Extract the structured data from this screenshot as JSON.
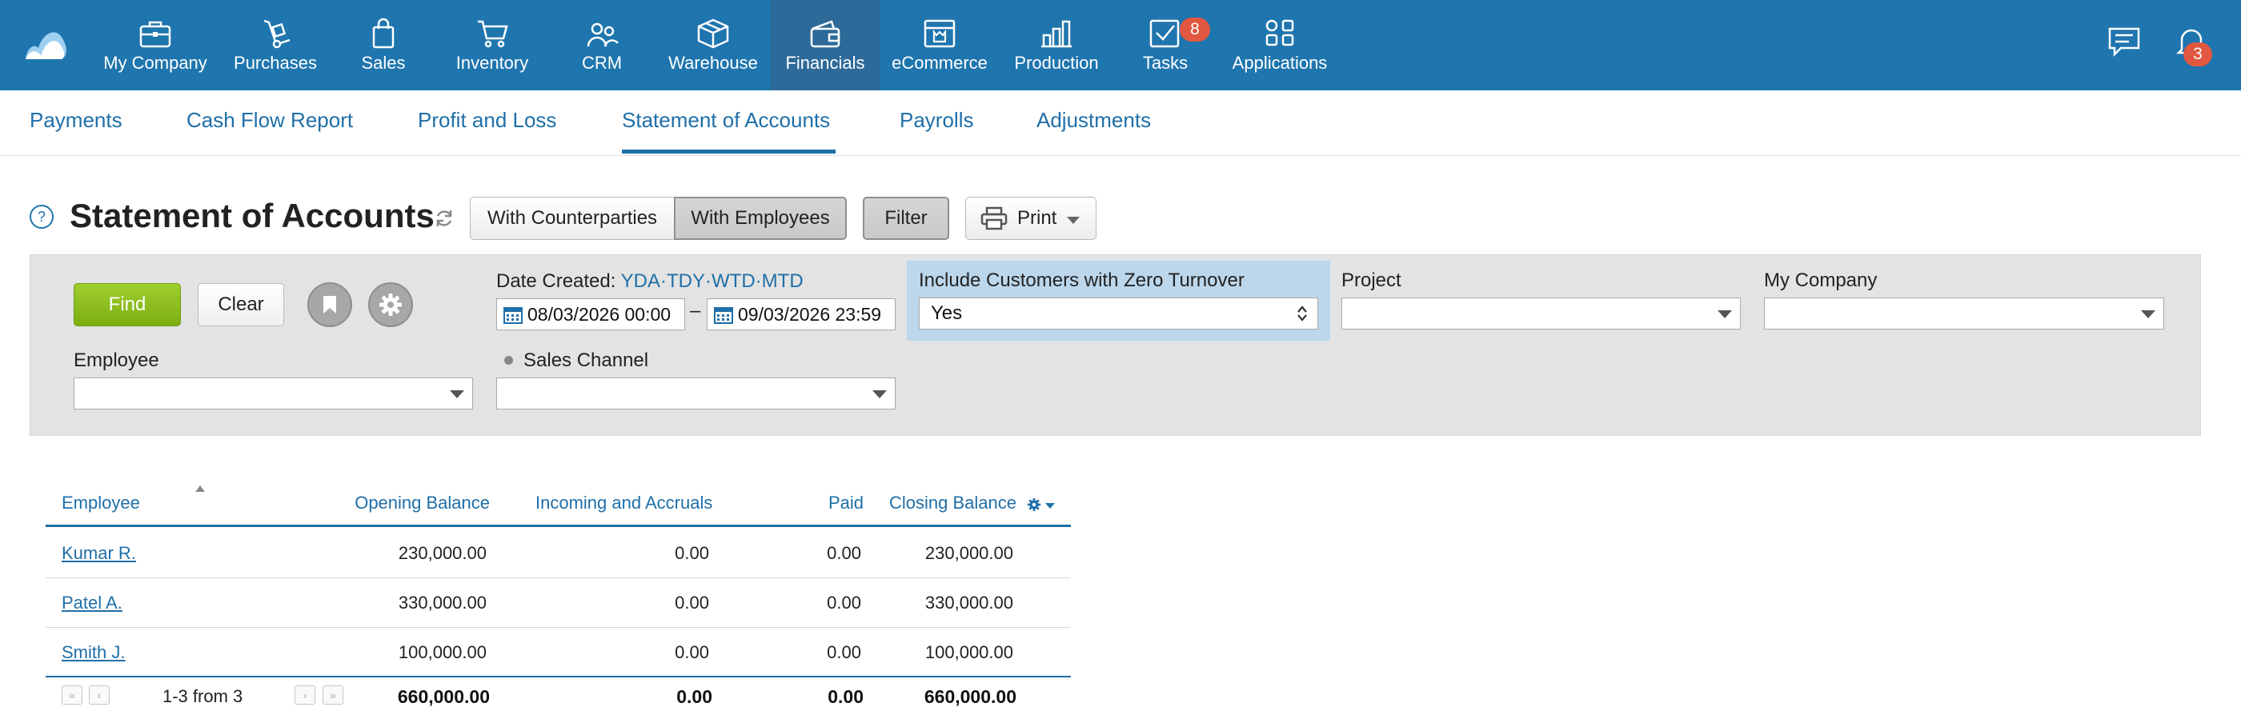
{
  "topnav": {
    "items": [
      {
        "label": "My Company",
        "icon": "briefcase-icon"
      },
      {
        "label": "Purchases",
        "icon": "hand-truck-icon"
      },
      {
        "label": "Sales",
        "icon": "shopping-bag-icon"
      },
      {
        "label": "Inventory",
        "icon": "cart-icon"
      },
      {
        "label": "CRM",
        "icon": "people-icon"
      },
      {
        "label": "Warehouse",
        "icon": "box-icon"
      },
      {
        "label": "Financials",
        "icon": "wallet-icon",
        "active": true
      },
      {
        "label": "eCommerce",
        "icon": "storefront-icon"
      },
      {
        "label": "Production",
        "icon": "factory-icon"
      },
      {
        "label": "Tasks",
        "icon": "checkbox-icon",
        "badge": "8"
      },
      {
        "label": "Applications",
        "icon": "apps-grid-icon"
      }
    ],
    "notifications_badge": "3",
    "colors": {
      "bar": "#1f75ae",
      "active": "#2d6a99",
      "badge": "#e2573f"
    }
  },
  "subnav": {
    "items": [
      "Payments",
      "Cash Flow Report",
      "Profit and Loss",
      "Statement of Accounts",
      "Payrolls",
      "Adjustments"
    ],
    "active": "Statement of Accounts"
  },
  "header": {
    "help": "?",
    "title": "Statement of Accounts",
    "toggle": [
      "With Counterparties",
      "With Employees"
    ],
    "toggle_active": "With Employees",
    "filter_label": "Filter",
    "print_label": "Print"
  },
  "filters": {
    "find_label": "Find",
    "clear_label": "Clear",
    "date_created_label": "Date Created:",
    "quick": [
      "YDA",
      "TDY",
      "WTD",
      "MTD"
    ],
    "quick_sep": "·",
    "date_from": "08/03/2026 00:00",
    "date_sep": "–",
    "date_to": "09/03/2026 23:59",
    "zero_turnover_label": "Include Customers with Zero Turnover",
    "zero_turnover_value": "Yes",
    "project_label": "Project",
    "project_value": "",
    "my_company_label": "My Company",
    "my_company_value": "",
    "employee_label": "Employee",
    "employee_value": "",
    "sales_channel_label": "Sales Channel",
    "sales_channel_value": ""
  },
  "table": {
    "columns": [
      "Employee",
      "Opening Balance",
      "Incoming and Accruals",
      "Paid",
      "Closing Balance"
    ],
    "rows": [
      {
        "employee": "Kumar R.",
        "opening": "230,000.00",
        "incoming": "0.00",
        "paid": "0.00",
        "closing": "230,000.00"
      },
      {
        "employee": "Patel A.",
        "opening": "330,000.00",
        "incoming": "0.00",
        "paid": "0.00",
        "closing": "330,000.00"
      },
      {
        "employee": "Smith J.",
        "opening": "100,000.00",
        "incoming": "0.00",
        "paid": "0.00",
        "closing": "100,000.00"
      }
    ],
    "footer": {
      "pager_text": "1-3 from 3",
      "opening": "660,000.00",
      "incoming": "0.00",
      "paid": "0.00",
      "closing": "660,000.00"
    }
  }
}
